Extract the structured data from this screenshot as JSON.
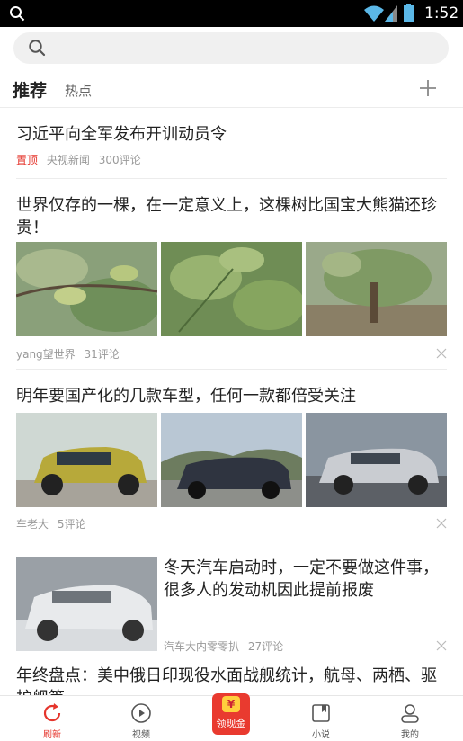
{
  "status_bar": {
    "time": "1:52"
  },
  "search": {
    "placeholder": ""
  },
  "tabs": [
    {
      "label": "推荐"
    },
    {
      "label": "热点"
    }
  ],
  "feed": [
    {
      "title": "习近平向全军发布开训动员令",
      "pin": "置顶",
      "source": "央视新闻",
      "comments": "300评论"
    },
    {
      "title": "世界仅存的一棵，在一定意义上，这棵树比国宝大熊猫还珍贵！",
      "source": "yang望世界",
      "comments": "31评论"
    },
    {
      "title": "明年要国产化的几款车型，任何一款都倍受关注",
      "source": "车老大",
      "comments": "5评论"
    },
    {
      "title": "冬天汽车启动时，一定不要做这件事，很多人的发动机因此提前报废",
      "source": "汽车大内零零扒",
      "comments": "27评论"
    },
    {
      "title": "年终盘点：美中俄日印现役水面战舰统计，航母、两栖、驱护舰等"
    }
  ],
  "bottom_nav": [
    {
      "label": "刷新",
      "icon": "refresh-icon",
      "active": true
    },
    {
      "label": "视频",
      "icon": "play-icon"
    },
    {
      "label": "领现金",
      "icon": "coin-icon"
    },
    {
      "label": "小说",
      "icon": "book-icon"
    },
    {
      "label": "我的",
      "icon": "person-icon"
    }
  ],
  "colors": {
    "accent": "#e5352c",
    "cash_button": "#e93a2f"
  }
}
